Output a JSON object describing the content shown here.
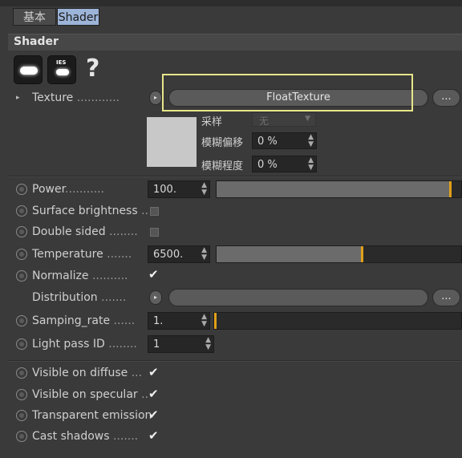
{
  "tabs": {
    "basic": "基本",
    "shader": "Shader"
  },
  "section": {
    "title": "Shader"
  },
  "help": {
    "glyph": "?"
  },
  "texture": {
    "label": "Texture",
    "dots": "............",
    "button_label": "FloatTexture",
    "more_label": "...",
    "arrow_glyph": "▸",
    "sampling_label": "采样",
    "sampling_value": "无",
    "blur_offset_label": "模糊偏移",
    "blur_offset_value": "0 %",
    "blur_scale_label": "模糊程度",
    "blur_scale_value": "0 %"
  },
  "power": {
    "label": "Power",
    "dots": "...........",
    "value": "100.",
    "slider_fraction": 0.96
  },
  "surface_brightness": {
    "label": "Surface brightness",
    "dots": ".."
  },
  "double_sided": {
    "label": "Double sided",
    "dots": "........"
  },
  "temperature": {
    "label": "Temperature",
    "dots": ".......",
    "value": "6500.",
    "slider_fraction": 0.6
  },
  "normalize": {
    "label": "Normalize",
    "dots": "..........",
    "checked": "✔"
  },
  "distribution": {
    "label": "Distribution",
    "dots": ".......",
    "more_label": "...",
    "arrow_glyph": "▸"
  },
  "samping_rate": {
    "label": "Samping_rate",
    "dots": "......",
    "value": "1.",
    "slider_fraction": 0.0
  },
  "light_pass_id": {
    "label": "Light pass ID",
    "dots": "........",
    "value": "1"
  },
  "visible_on_diffuse": {
    "label": "Visible on diffuse",
    "dots": "...",
    "checked": "✔"
  },
  "visible_on_specular": {
    "label": "Visible on specular",
    "dots": "..",
    "checked": "✔"
  },
  "transparent_emission": {
    "label": "Transparent emission",
    "checked": "✔"
  },
  "cast_shadows": {
    "label": "Cast shadows",
    "dots": ".......",
    "checked": "✔"
  },
  "spinner": {
    "up": "▲",
    "down": "▼"
  },
  "colors": {
    "accent_marker": "#e0a01a",
    "active_tab": "#9cb4d8",
    "highlight_box": "#e6e68a"
  }
}
